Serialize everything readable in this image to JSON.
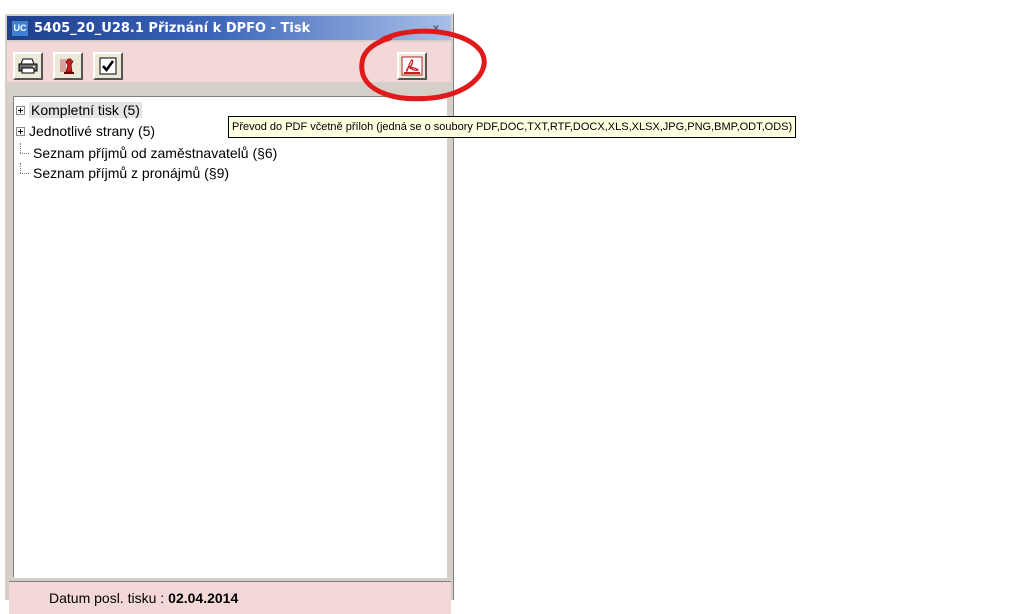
{
  "window": {
    "title": "5405_20_U28.1 Přiznání k DPFO - Tisk",
    "app_icon_text": "UC",
    "close_glyph": "×"
  },
  "toolbar": {
    "buttons": [
      {
        "icon": "printer-icon"
      },
      {
        "icon": "chess-piece-icon"
      },
      {
        "icon": "checkmark-icon"
      },
      {
        "icon": "pdf-export-icon"
      }
    ]
  },
  "tree": {
    "items": [
      {
        "label": "Kompletní tisk (5)",
        "type": "expandable",
        "selected": true
      },
      {
        "label": "Jednotlivé strany (5)",
        "type": "expandable"
      },
      {
        "label": "Seznam příjmů od zaměstnavatelů (§6)",
        "type": "leaf"
      },
      {
        "label": "Seznam příjmů z pronájmů (§9)",
        "type": "leaf"
      }
    ]
  },
  "tooltip": {
    "text": "Převod do PDF včetně příloh  (jedná se o soubory PDF,DOC,TXT,RTF,DOCX,XLS,XLSX,JPG,PNG,BMP,ODT,ODS)"
  },
  "status": {
    "label": "Datum posl. tisku :",
    "value": "02.04.2014"
  },
  "colors": {
    "toolbar_bg": "#f4d8d8",
    "title_bar": "#1f3f8e",
    "tooltip_bg": "#ffffe1",
    "annotation": "#e01a1a"
  }
}
